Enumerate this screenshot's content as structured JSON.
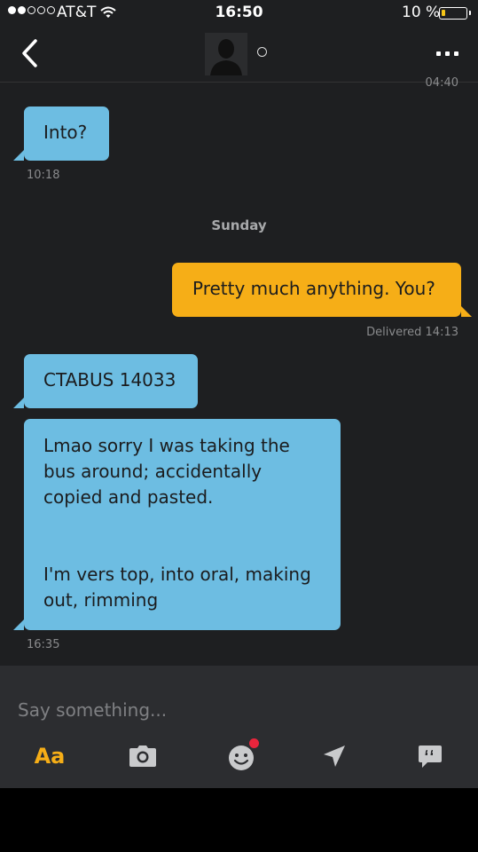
{
  "status_bar": {
    "carrier": "AT&T",
    "time": "16:50",
    "battery_percent": "10 %",
    "signal_bars_on": 2,
    "signal_bars_total": 5
  },
  "header": {
    "back_icon": "chevron-left-icon",
    "more_icon": "ellipsis-icon",
    "contact_status": "offline"
  },
  "conversation": {
    "cut_off_time": "04:40",
    "day_separator": "Sunday",
    "messages": [
      {
        "direction": "incoming",
        "text": "Into?",
        "time": "10:18"
      },
      {
        "direction": "outgoing",
        "text": "Pretty much anything. You?",
        "status": "Delivered 14:13"
      },
      {
        "direction": "incoming",
        "text": "CTABUS 14033"
      },
      {
        "direction": "incoming",
        "lines": [
          "Lmao sorry I was taking the",
          "bus around; accidentally",
          "copied and pasted.",
          "",
          "",
          "I'm vers top, into oral, making",
          "out, rimming"
        ],
        "time": "16:35"
      }
    ]
  },
  "compose": {
    "placeholder": "Say something...",
    "text_format_label": "Aa",
    "tools": [
      "text-format-icon",
      "camera-icon",
      "sticker-icon",
      "location-icon",
      "saved-phrases-icon"
    ]
  },
  "colors": {
    "incoming_bubble": "#6dbde2",
    "outgoing_bubble": "#f6ae17",
    "background": "#1e1f21",
    "compose_background": "#2c2d30",
    "accent": "#f6ae17",
    "badge": "#e8253c"
  }
}
